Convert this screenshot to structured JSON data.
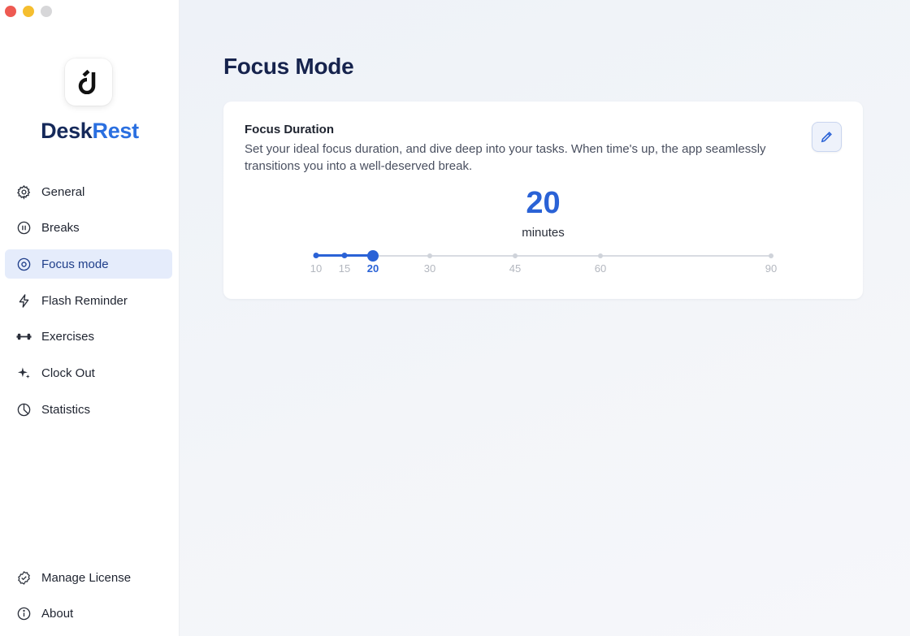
{
  "app": {
    "brand_part1": "Desk",
    "brand_part2": "Rest",
    "accent_color": "#2a62d6"
  },
  "sidebar": {
    "items": [
      {
        "label": "General",
        "icon": "gear-icon"
      },
      {
        "label": "Breaks",
        "icon": "pause-circle-icon"
      },
      {
        "label": "Focus mode",
        "icon": "focus-target-icon",
        "active": true
      },
      {
        "label": "Flash Reminder",
        "icon": "lightning-icon"
      },
      {
        "label": "Exercises",
        "icon": "dumbbell-icon"
      },
      {
        "label": "Clock Out",
        "icon": "sparkle-icon"
      },
      {
        "label": "Statistics",
        "icon": "pie-chart-icon"
      }
    ],
    "bottom_items": [
      {
        "label": "Manage License",
        "icon": "verified-badge-icon"
      },
      {
        "label": "About",
        "icon": "info-icon"
      }
    ]
  },
  "main": {
    "title": "Focus Mode",
    "card": {
      "title": "Focus Duration",
      "description": "Set your ideal focus duration, and dive deep into your tasks. When time's up, the app seamlessly transitions you into a well-deserved break.",
      "value": "20",
      "unit": "minutes",
      "slider": {
        "min": 10,
        "max": 90,
        "selected": 20,
        "stops": [
          "10",
          "15",
          "20",
          "30",
          "45",
          "60",
          "90"
        ]
      }
    }
  }
}
